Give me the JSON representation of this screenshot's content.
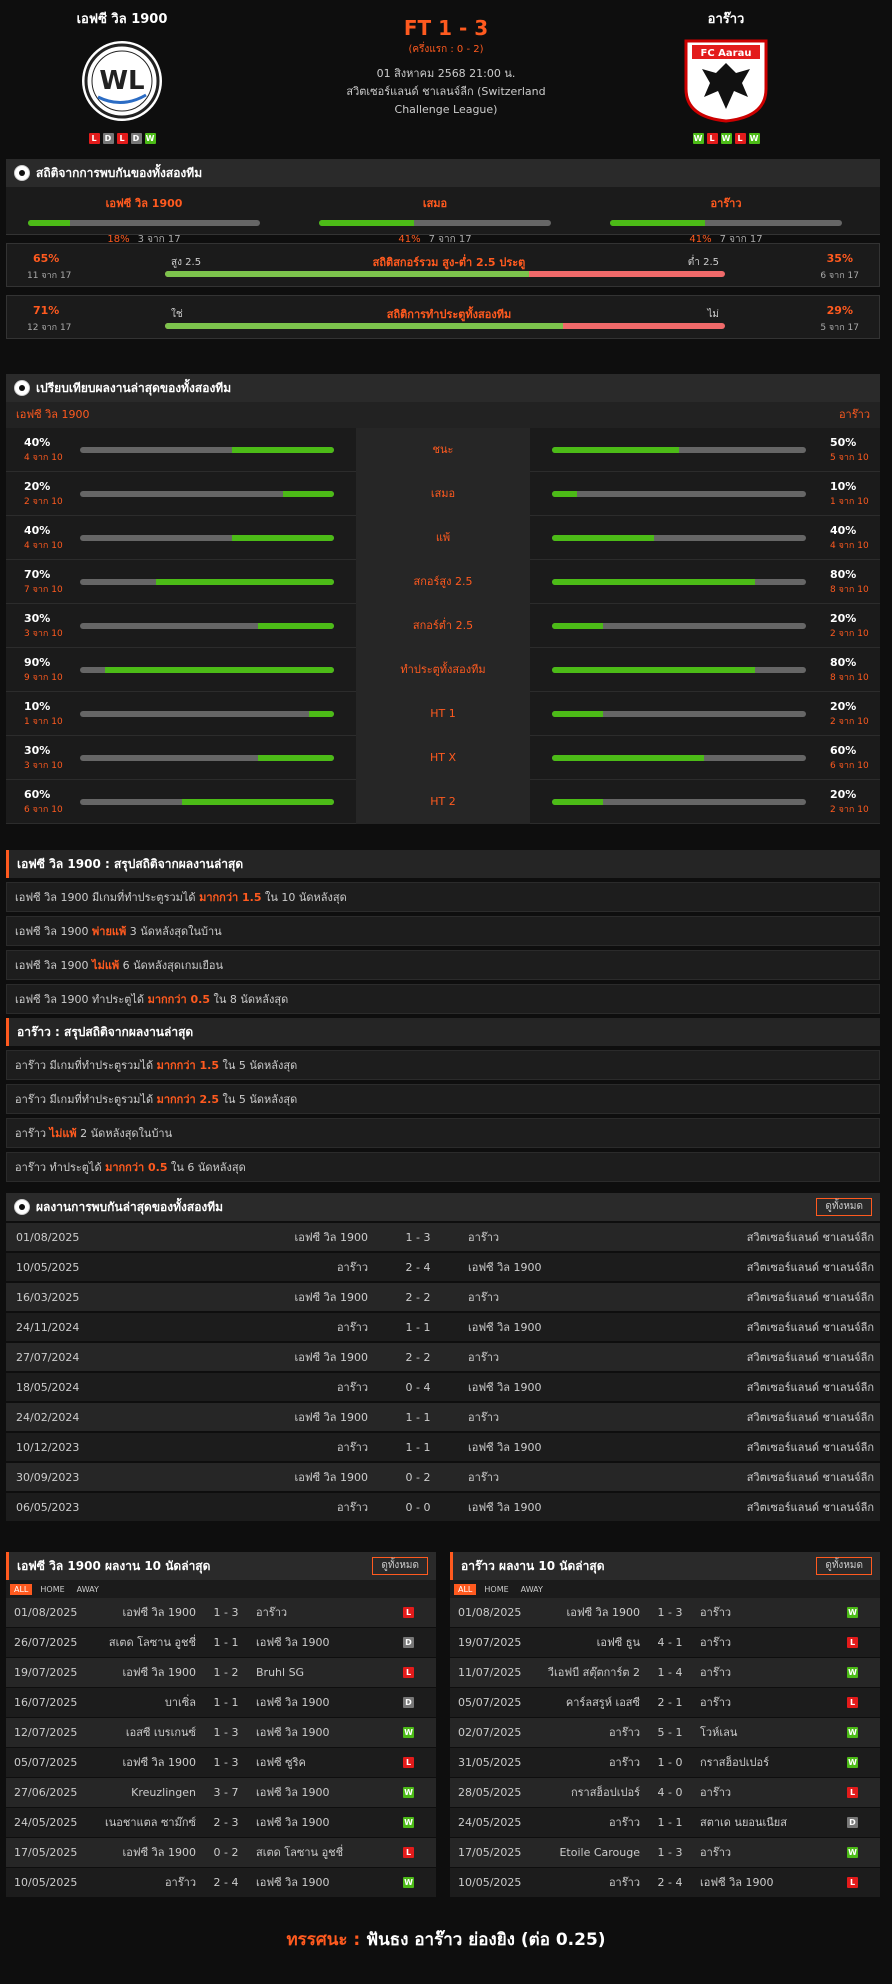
{
  "match": {
    "home": "เอฟซี วิล 1900",
    "away": "อาร๊าว",
    "score": "FT 1 - 3",
    "halftime": "(ครึ่งแรก : 0 - 2)",
    "date": "01 สิงหาคม 2568 21:00 น.",
    "league1": "สวิตเซอร์แลนด์ ชาเลนจ์ลีก (Switzerland",
    "league2": "Challenge League)",
    "home_form": [
      "L",
      "D",
      "L",
      "D",
      "W"
    ],
    "away_form": [
      "W",
      "L",
      "W",
      "L",
      "W"
    ],
    "away_logo_text": "FC Aarau"
  },
  "h2h": {
    "title": "สถิติจากการพบกันของทั้งสองทีม",
    "cols": [
      {
        "team": "เอฟซี วิล 1900",
        "pct": "18%",
        "sub": "3 จาก 17",
        "frac": 0.18
      },
      {
        "team": "เสมอ",
        "pct": "41%",
        "sub": "7 จาก 17",
        "frac": 0.41
      },
      {
        "team": "อาร๊าว",
        "pct": "41%",
        "sub": "7 จาก 17",
        "frac": 0.41
      }
    ],
    "ou": {
      "lpct": "65%",
      "lsub": "11 จาก 17",
      "lab": "สูง 2.5",
      "title": "สถิติสกอร์รวม สูง-ต่ำ 2.5 ประตู",
      "rlab": "ต่ำ 2.5",
      "rpct": "35%",
      "rsub": "6 จาก 17",
      "frac": 0.65
    },
    "btts": {
      "lpct": "71%",
      "lsub": "12 จาก 17",
      "lab": "ใช่",
      "title": "สถิติการทำประตูทั้งสองทีม",
      "rlab": "ไม่",
      "rpct": "29%",
      "rsub": "5 จาก 17",
      "frac": 0.71
    }
  },
  "cmp": {
    "title": "เปรียบเทียบผลงานล่าสุดของทั้งสองทีม",
    "home": "เอฟซี วิล 1900",
    "away": "อาร๊าว",
    "rows": [
      {
        "label": "ชนะ",
        "l": "40%",
        "ls": "4 จาก 10",
        "lf": 0.4,
        "r": "50%",
        "rs": "5 จาก 10",
        "rf": 0.5
      },
      {
        "label": "เสมอ",
        "l": "20%",
        "ls": "2 จาก 10",
        "lf": 0.2,
        "r": "10%",
        "rs": "1 จาก 10",
        "rf": 0.1
      },
      {
        "label": "แพ้",
        "l": "40%",
        "ls": "4 จาก 10",
        "lf": 0.4,
        "r": "40%",
        "rs": "4 จาก 10",
        "rf": 0.4
      },
      {
        "label": "สกอร์สูง 2.5",
        "l": "70%",
        "ls": "7 จาก 10",
        "lf": 0.7,
        "r": "80%",
        "rs": "8 จาก 10",
        "rf": 0.8
      },
      {
        "label": "สกอร์ต่ำ 2.5",
        "l": "30%",
        "ls": "3 จาก 10",
        "lf": 0.3,
        "r": "20%",
        "rs": "2 จาก 10",
        "rf": 0.2
      },
      {
        "label": "ทำประตูทั้งสองทีม",
        "l": "90%",
        "ls": "9 จาก 10",
        "lf": 0.9,
        "r": "80%",
        "rs": "8 จาก 10",
        "rf": 0.8
      },
      {
        "label": "HT 1",
        "l": "10%",
        "ls": "1 จาก 10",
        "lf": 0.1,
        "r": "20%",
        "rs": "2 จาก 10",
        "rf": 0.2
      },
      {
        "label": "HT X",
        "l": "30%",
        "ls": "3 จาก 10",
        "lf": 0.3,
        "r": "60%",
        "rs": "6 จาก 10",
        "rf": 0.6
      },
      {
        "label": "HT 2",
        "l": "60%",
        "ls": "6 จาก 10",
        "lf": 0.6,
        "r": "20%",
        "rs": "2 จาก 10",
        "rf": 0.2
      }
    ]
  },
  "sum_home": {
    "title": "เอฟซี วิล 1900 : สรุปสถิติจากผลงานล่าสุด",
    "rows": [
      [
        "เอฟซี วิล 1900  มีเกมที่ทำประตูรวมได้ ",
        "มากกว่า 1.5",
        " ใน 10 นัดหลังสุด"
      ],
      [
        "เอฟซี วิล 1900 ",
        "พ่ายแพ้",
        " 3 นัดหลังสุดในบ้าน"
      ],
      [
        "เอฟซี วิล 1900 ",
        "ไม่แพ้",
        " 6 นัดหลังสุดเกมเยือน"
      ],
      [
        "เอฟซี วิล 1900  ทำประตูได้ ",
        "มากกว่า 0.5",
        " ใน 8 นัดหลังสุด"
      ]
    ]
  },
  "sum_away": {
    "title": "อาร๊าว : สรุปสถิติจากผลงานล่าสุด",
    "rows": [
      [
        "อาร๊าว มีเกมที่ทำประตูรวมได้ ",
        "มากกว่า 1.5",
        " ใน 5 นัดหลังสุด"
      ],
      [
        "อาร๊าว มีเกมที่ทำประตูรวมได้ ",
        "มากกว่า 2.5",
        " ใน 5 นัดหลังสุด"
      ],
      [
        "อาร๊าว ",
        "ไม่แพ้",
        " 2 นัดหลังสุดในบ้าน"
      ],
      [
        "อาร๊าว ทำประตูได้ ",
        "มากกว่า 0.5",
        " ใน 6 นัดหลังสุด"
      ]
    ]
  },
  "meet": {
    "title": "ผลงานการพบกันล่าสุดของทั้งสองทีม",
    "btn": "ดูทั้งหมด",
    "rows": [
      [
        "01/08/2025",
        "เอฟซี วิล 1900",
        "1 - 3",
        "อาร๊าว",
        "สวิตเซอร์แลนด์ ชาเลนจ์ลีก"
      ],
      [
        "10/05/2025",
        "อาร๊าว",
        "2 - 4",
        "เอฟซี วิล 1900",
        "สวิตเซอร์แลนด์ ชาเลนจ์ลีก"
      ],
      [
        "16/03/2025",
        "เอฟซี วิล 1900",
        "2 - 2",
        "อาร๊าว",
        "สวิตเซอร์แลนด์ ชาเลนจ์ลีก"
      ],
      [
        "24/11/2024",
        "อาร๊าว",
        "1 - 1",
        "เอฟซี วิล 1900",
        "สวิตเซอร์แลนด์ ชาเลนจ์ลีก"
      ],
      [
        "27/07/2024",
        "เอฟซี วิล 1900",
        "2 - 2",
        "อาร๊าว",
        "สวิตเซอร์แลนด์ ชาเลนจ์ลีก"
      ],
      [
        "18/05/2024",
        "อาร๊าว",
        "0 - 4",
        "เอฟซี วิล 1900",
        "สวิตเซอร์แลนด์ ชาเลนจ์ลีก"
      ],
      [
        "24/02/2024",
        "เอฟซี วิล 1900",
        "1 - 1",
        "อาร๊าว",
        "สวิตเซอร์แลนด์ ชาเลนจ์ลีก"
      ],
      [
        "10/12/2023",
        "อาร๊าว",
        "1 - 1",
        "เอฟซี วิล 1900",
        "สวิตเซอร์แลนด์ ชาเลนจ์ลีก"
      ],
      [
        "30/09/2023",
        "เอฟซี วิล 1900",
        "0 - 2",
        "อาร๊าว",
        "สวิตเซอร์แลนด์ ชาเลนจ์ลีก"
      ],
      [
        "06/05/2023",
        "อาร๊าว",
        "0 - 0",
        "เอฟซี วิล 1900",
        "สวิตเซอร์แลนด์ ชาเลนจ์ลีก"
      ]
    ]
  },
  "tabs": [
    "ALL",
    "HOME",
    "AWAY"
  ],
  "last_home": {
    "title": "เอฟซี วิล 1900 ผลงาน 10 นัดล่าสุด",
    "btn": "ดูทั้งหมด",
    "rows": [
      [
        "01/08/2025",
        "เอฟซี วิล 1900",
        "1 - 3",
        "อาร๊าว",
        "L"
      ],
      [
        "26/07/2025",
        "สเตด โลซาน อูชชี่",
        "1 - 1",
        "เอฟซี วิล 1900",
        "D"
      ],
      [
        "19/07/2025",
        "เอฟซี วิล 1900",
        "1 - 2",
        "Bruhl SG",
        "L"
      ],
      [
        "16/07/2025",
        "บาเซิ่ล",
        "1 - 1",
        "เอฟซี วิล 1900",
        "D"
      ],
      [
        "12/07/2025",
        "เอสซี เบรเกนซ์",
        "1 - 3",
        "เอฟซี วิล 1900",
        "W"
      ],
      [
        "05/07/2025",
        "เอฟซี วิล 1900",
        "1 - 3",
        "เอฟซี ซูริค",
        "L"
      ],
      [
        "27/06/2025",
        "Kreuzlingen",
        "3 - 7",
        "เอฟซี วิล 1900",
        "W"
      ],
      [
        "24/05/2025",
        "เนอชาแตล ซาม๊กซ์",
        "2 - 3",
        "เอฟซี วิล 1900",
        "W"
      ],
      [
        "17/05/2025",
        "เอฟซี วิล 1900",
        "0 - 2",
        "สเตด โลซาน อูชชี่",
        "L"
      ],
      [
        "10/05/2025",
        "อาร๊าว",
        "2 - 4",
        "เอฟซี วิล 1900",
        "W"
      ]
    ]
  },
  "last_away": {
    "title": "อาร๊าว ผลงาน 10 นัดล่าสุด",
    "btn": "ดูทั้งหมด",
    "rows": [
      [
        "01/08/2025",
        "เอฟซี วิล 1900",
        "1 - 3",
        "อาร๊าว",
        "W"
      ],
      [
        "19/07/2025",
        "เอฟซี ธูน",
        "4 - 1",
        "อาร๊าว",
        "L"
      ],
      [
        "11/07/2025",
        "วีเอฟบี สตุ๊ตการ์ต 2",
        "1 - 4",
        "อาร๊าว",
        "W"
      ],
      [
        "05/07/2025",
        "คาร์ลสรูห์ เอสซี",
        "2 - 1",
        "อาร๊าว",
        "L"
      ],
      [
        "02/07/2025",
        "อาร๊าว",
        "5 - 1",
        "โวห์เลน",
        "W"
      ],
      [
        "31/05/2025",
        "อาร๊าว",
        "1 - 0",
        "กราสฮ็อปเปอร์",
        "W"
      ],
      [
        "28/05/2025",
        "กราสฮ็อปเปอร์",
        "4 - 0",
        "อาร๊าว",
        "L"
      ],
      [
        "24/05/2025",
        "อาร๊าว",
        "1 - 1",
        "สตาเด นยอนเนียส",
        "D"
      ],
      [
        "17/05/2025",
        "Etoile Carouge",
        "1 - 3",
        "อาร๊าว",
        "W"
      ],
      [
        "10/05/2025",
        "อาร๊าว",
        "2 - 4",
        "เอฟซี วิล 1900",
        "L"
      ]
    ]
  },
  "verdict": {
    "label": "ทรรศนะ : ",
    "text": " ฟันธง อาร๊าว ย่องยิง (ต่อ 0.25)"
  }
}
